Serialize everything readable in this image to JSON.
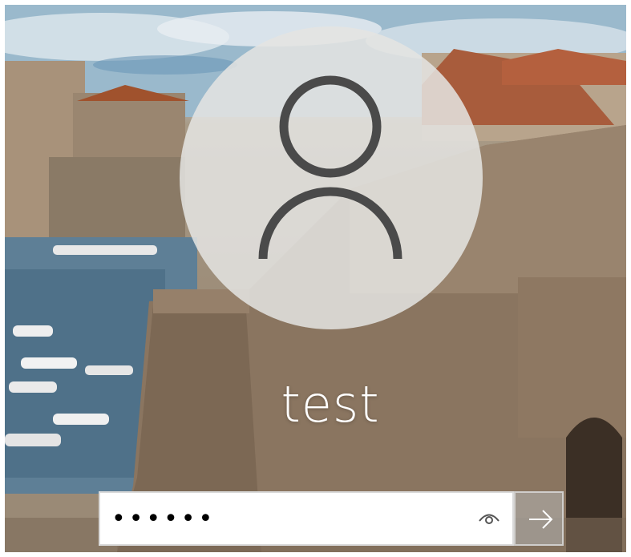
{
  "user": {
    "name": "test"
  },
  "password": {
    "masked_value": "••••••"
  },
  "icons": {
    "avatar": "user-silhouette-icon",
    "reveal": "eye-icon",
    "submit": "arrow-right-icon"
  },
  "colors": {
    "avatar_circle": "#e4e4e2",
    "avatar_stroke": "#4a4a4a",
    "field_background": "#ffffff",
    "submit_background": "#b4b4b4"
  }
}
